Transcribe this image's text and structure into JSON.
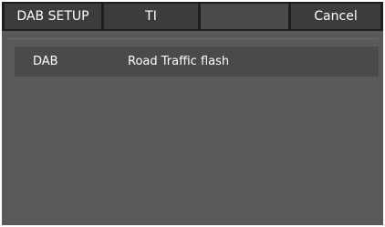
{
  "header": {
    "tabs": [
      {
        "label": "DAB SETUP"
      },
      {
        "label": "TI"
      },
      {
        "label": ""
      },
      {
        "label": "Cancel"
      }
    ]
  },
  "main": {
    "rows": [
      {
        "label": "DAB",
        "value": "Road Traffic flash"
      }
    ]
  }
}
